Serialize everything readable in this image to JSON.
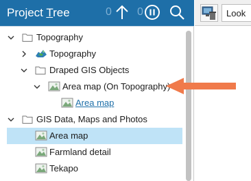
{
  "panel": {
    "title_prefix": "Project ",
    "title_underlined": "T",
    "title_suffix": "ree",
    "count_a": "0",
    "count_b": "0",
    "buttons": [
      "up-arrow-icon",
      "pause-icon",
      "search-icon"
    ]
  },
  "tree": [
    {
      "label": "Topography",
      "chevron": "down",
      "icon": "folder",
      "selected": false,
      "link": false
    },
    {
      "label": "Topography",
      "chevron": "right",
      "icon": "surface",
      "selected": false,
      "link": false
    },
    {
      "label": "Draped GIS Objects",
      "chevron": "down",
      "icon": "folder",
      "selected": false,
      "link": false
    },
    {
      "label": "Area map (On Topography)",
      "chevron": "down",
      "icon": "image",
      "selected": false,
      "link": false
    },
    {
      "label": "Area map",
      "chevron": "none",
      "icon": "image",
      "selected": false,
      "link": true
    },
    {
      "label": "GIS Data, Maps and Photos",
      "chevron": "down",
      "icon": "folder",
      "selected": false,
      "link": false
    },
    {
      "label": "Area map",
      "chevron": "none",
      "icon": "image",
      "selected": true,
      "link": false
    },
    {
      "label": "Farmland detail",
      "chevron": "none",
      "icon": "image",
      "selected": false,
      "link": false
    },
    {
      "label": "Tekapo",
      "chevron": "none",
      "icon": "image",
      "selected": false,
      "link": false
    }
  ],
  "right_toolbar": {
    "look_label": "Look"
  },
  "colors": {
    "header": "#1e6fa8",
    "selection": "#bfe3f7",
    "arrow": "#f07a4b",
    "link": "#1e6fa8"
  }
}
